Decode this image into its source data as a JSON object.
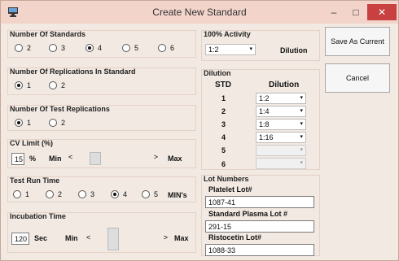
{
  "window": {
    "title": "Create New Standard",
    "min": "–",
    "max": "□",
    "close": "✕"
  },
  "num_standards": {
    "title": "Number Of Standards",
    "options": [
      "2",
      "3",
      "4",
      "5",
      "6"
    ],
    "selected": "4"
  },
  "replications_in_standard": {
    "title": "Number Of Replications In Standard",
    "options": [
      "1",
      "2"
    ],
    "selected": "1"
  },
  "test_replications": {
    "title": "Number Of Test Replications",
    "options": [
      "1",
      "2"
    ],
    "selected": "1"
  },
  "cv_limit": {
    "title": "CV Limit (%)",
    "value": "15",
    "unit": "%",
    "min_label": "Min",
    "max_label": "Max",
    "left_arrow": "<",
    "right_arrow": ">"
  },
  "test_run_time": {
    "title": "Test Run Time",
    "options": [
      "1",
      "2",
      "3",
      "4",
      "5"
    ],
    "selected": "4",
    "unit": "MIN's"
  },
  "incubation": {
    "title": "Incubation Time",
    "value": "120",
    "unit": "Sec",
    "min_label": "Min",
    "max_label": "Max",
    "left_arrow": "<",
    "right_arrow": ">"
  },
  "activity": {
    "title": "100% Activity",
    "value": "1:2",
    "dilution_label": "Dilution"
  },
  "dilution": {
    "title": "Dilution",
    "col_std": "STD",
    "col_dilution": "Dilution",
    "rows": [
      {
        "std": "1",
        "value": "1:2"
      },
      {
        "std": "2",
        "value": "1:4"
      },
      {
        "std": "3",
        "value": "1:8"
      },
      {
        "std": "4",
        "value": "1:16"
      },
      {
        "std": "5",
        "value": ""
      },
      {
        "std": "6",
        "value": ""
      }
    ]
  },
  "lots": {
    "title": "Lot Numbers",
    "platelet_label": "Platelet Lot#",
    "platelet_value": "1087-41",
    "plasma_label": "Standard Plasma Lot #",
    "plasma_value": "291-15",
    "ristocetin_label": "Ristocetin Lot#",
    "ristocetin_value": "1088-33"
  },
  "buttons": {
    "save": "Save As Current",
    "cancel": "Cancel"
  },
  "icons": {
    "app": "app-icon",
    "dropdown": "▾"
  }
}
